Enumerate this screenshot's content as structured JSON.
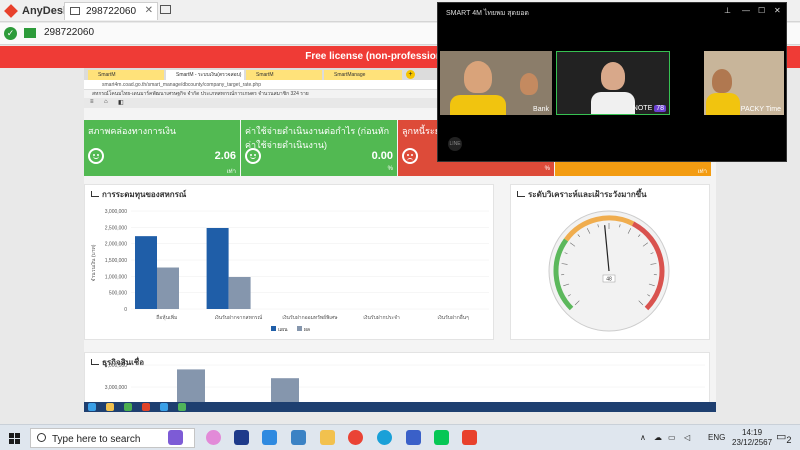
{
  "anydesk": {
    "app_name": "AnyDesk",
    "tab_id": "298722060",
    "address": "298722060",
    "license_banner": "Free license (non-professional use). Sta"
  },
  "remote": {
    "browser_tabs": [
      "SmartM",
      "SmartM - ระบบเงิน(ตรวจสอบ)",
      "SmartM",
      "SmartManage"
    ],
    "url": "smart4m.coad.go.th/smart_manage/dbcounty/company_target_rate.php",
    "header_title": "สหกรณ์โคนมไทย-เดนมาร์คพัฒนาเศรษฐกิจ จำกัด ประเภทสหกรณ์การเกษตร จำนวนสมาชิก 324 ราย",
    "cards": [
      {
        "title": "สภาพคล่องทางการเงิน",
        "value": "2.06",
        "unit": "เท่า",
        "color": "#52b952",
        "mood": "happy"
      },
      {
        "title": "ค่าใช้จ่ายดำเนินงานต่อกำไร (ก่อนหักค่าใช้จ่ายดำเนินงาน)",
        "value": "0.00",
        "unit": "%",
        "color": "#52b952",
        "mood": "happy"
      },
      {
        "title": "ลูกหนี้ระยะ",
        "value": "",
        "unit": "%",
        "color": "#dd4b39",
        "mood": "sad"
      },
      {
        "title": "",
        "value": "",
        "unit": "เท่า",
        "color": "#f39c12",
        "mood": "none"
      }
    ],
    "panels": {
      "capital_title": "การระดมทุนของสหกรณ์",
      "gauge_title": "ระดับวิเคราะห์และเฝ้าระวังมากขึ้น",
      "credit_title": "ธุรกิจสินเชื่อ"
    }
  },
  "chart_data": [
    {
      "type": "bar",
      "title": "การระดมทุนของสหกรณ์",
      "ylabel": "จำนวนเงิน (บาท)",
      "ylim": [
        0,
        3000000
      ],
      "yticks": [
        "3,000,000",
        "2,500,000",
        "2,000,000",
        "1,500,000",
        "1,000,000",
        "500,000",
        "0"
      ],
      "categories": [
        "ถือหุ้นเพิ่ม",
        "เงินรับฝากจากสหกรณ์",
        "เงินรับฝากออมทรัพย์พิเศษ",
        "เงินรับฝากประจำ",
        "เงินรับฝากอื่นๆ"
      ],
      "series": [
        {
          "name": "แผน",
          "color": "#1f5ea8",
          "values": [
            2230000,
            2480000,
            0,
            0,
            0
          ]
        },
        {
          "name": "ผล",
          "color": "#8596ad",
          "values": [
            1270000,
            980000,
            0,
            0,
            0
          ]
        }
      ],
      "legend": "bottom"
    },
    {
      "type": "bar",
      "title": "ธุรกิจสินเชื่อ",
      "ylim": [
        0,
        4000000
      ],
      "yticks": [
        "4,000,000",
        "3,000,000"
      ],
      "categories": [
        "",
        ""
      ],
      "series": [
        {
          "name": "",
          "color": "#8596ad",
          "values": [
            3800000,
            3400000
          ]
        }
      ]
    }
  ],
  "gauge": {
    "value": 48,
    "min": 0,
    "max": 100
  },
  "call": {
    "title": "SMART 4M ไทยพม สุดยอด",
    "participants": [
      {
        "name": "Bank"
      },
      {
        "name": "NOTE"
      },
      {
        "name": "PACKY Time"
      }
    ],
    "badge": "78",
    "line_label": "LINE"
  },
  "taskbar": {
    "search_placeholder": "Type here to search",
    "lang": "ENG",
    "time": "14:19",
    "date": "23/12/2567",
    "notification_count": "2"
  }
}
